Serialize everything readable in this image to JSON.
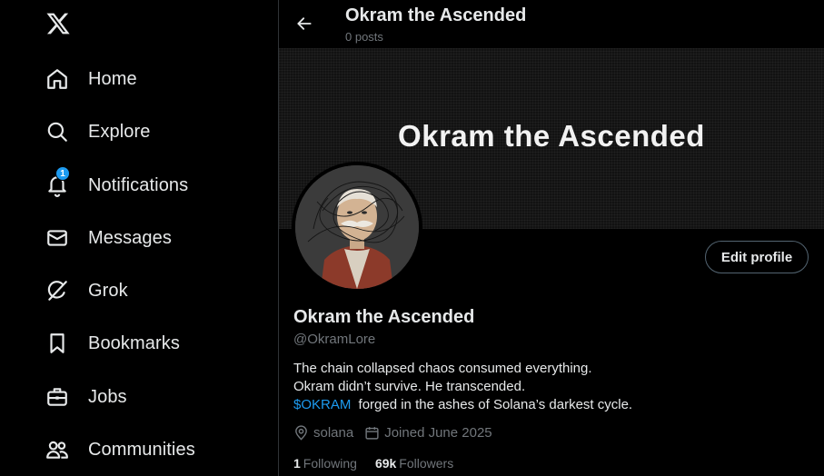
{
  "sidebar": {
    "logo_icon": "x-logo-icon",
    "items": [
      {
        "label": "Home",
        "icon": "home-icon"
      },
      {
        "label": "Explore",
        "icon": "search-icon"
      },
      {
        "label": "Notifications",
        "icon": "bell-icon",
        "badge": "1"
      },
      {
        "label": "Messages",
        "icon": "envelope-icon"
      },
      {
        "label": "Grok",
        "icon": "grok-icon"
      },
      {
        "label": "Bookmarks",
        "icon": "bookmark-icon"
      },
      {
        "label": "Jobs",
        "icon": "briefcase-icon"
      },
      {
        "label": "Communities",
        "icon": "people-icon"
      }
    ]
  },
  "header": {
    "title": "Okram the Ascended",
    "subtitle": "0 posts"
  },
  "banner": {
    "text": "Okram the Ascended"
  },
  "profile": {
    "display_name": "Okram the Ascended",
    "handle": "@OkramLore",
    "edit_button": "Edit profile",
    "bio_line1": "The chain collapsed chaos consumed everything.",
    "bio_line2": "Okram didn’t survive. He transcended.",
    "bio_cashtag": "$OKRAM",
    "bio_line3_rest": " forged in the ashes of Solana’s darkest cycle.",
    "location": "solana",
    "joined": "Joined June 2025",
    "following_count": "1",
    "following_label": "Following",
    "followers_count": "69k",
    "followers_label": "Followers"
  },
  "colors": {
    "accent": "#1d9bf0",
    "text": "#e7e9ea",
    "muted": "#71767b",
    "border": "#536471"
  }
}
